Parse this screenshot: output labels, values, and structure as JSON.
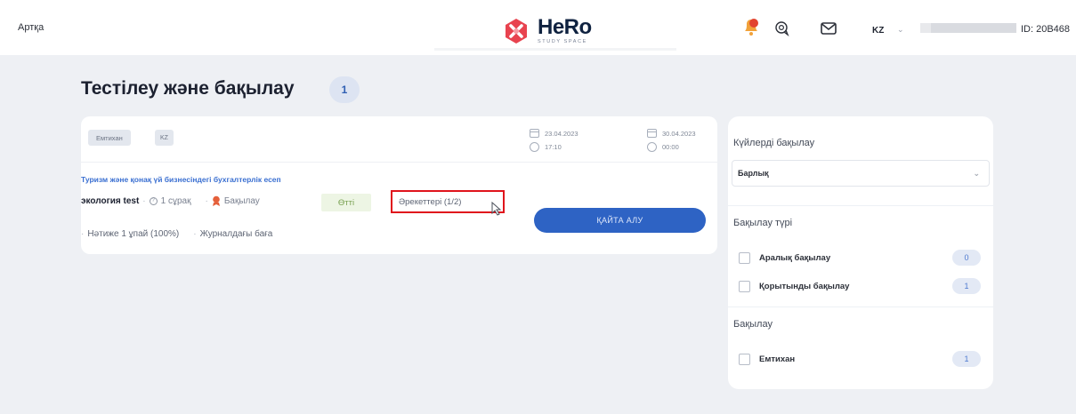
{
  "header": {
    "back_label": "Артқа",
    "logo_title": "HeRo",
    "logo_subtitle": "STUDY SPACE",
    "language": "KZ",
    "language_chevron": "⌄",
    "user_id": "ID: 20B468",
    "icons": [
      "notification-bell-icon",
      "chat-icon",
      "mail-icon",
      "chevron-down-icon"
    ],
    "brand_color": "#e8434f"
  },
  "page": {
    "title": "Тестілеу және бақылау",
    "count": "1"
  },
  "test_card": {
    "tag_exam": "Емтихан",
    "tag_lang": "KZ",
    "start_date": "23.04.2023",
    "start_time": "17:10",
    "end_date": "30.04.2023",
    "end_time": "00:00",
    "course": "Туризм және қонақ үй бизнесіндегі бухгалтерлік есеп",
    "subject": "экология test",
    "questions": "1 сұрақ",
    "control_type": "Бақылау",
    "status": "Өтті",
    "attempts": "Әрекеттері (1/2)",
    "result": "Нәтиже 1 ұпай (100%)",
    "journal_grade": "Журналдағы баға",
    "retake_button": "ҚАЙТА АЛУ",
    "accent_color": "#2e63c4",
    "highlight_color": "#e0141c"
  },
  "sidebar": {
    "state_title": "Күйлерді бақылау",
    "state_select_value": "Барлық",
    "control_type_title": "Бақылау түрі",
    "control_types": [
      {
        "label": "Аралық бақылау",
        "count": "0"
      },
      {
        "label": "Қорытынды бақылау",
        "count": "1"
      }
    ],
    "control_title": "Бақылау",
    "controls": [
      {
        "label": "Емтихан",
        "count": "1"
      }
    ]
  }
}
